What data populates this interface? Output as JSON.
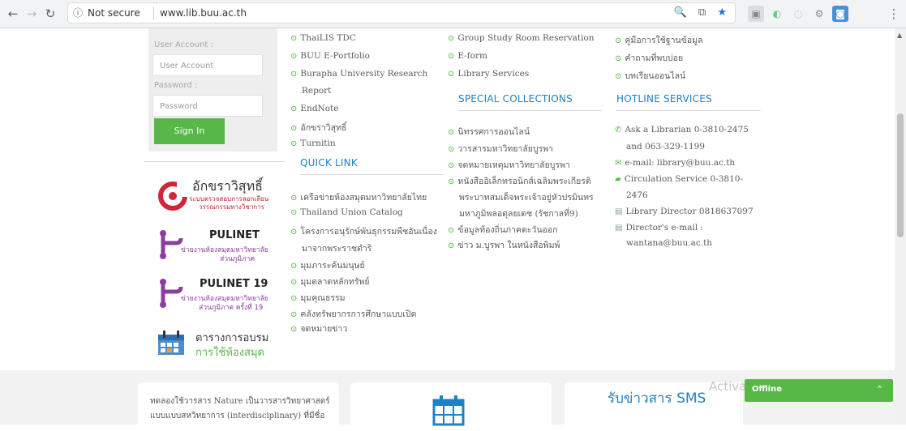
{
  "browser": {
    "security_label": "Not secure",
    "url": "www.lib.buu.ac.th"
  },
  "login": {
    "account_label": "User Account :",
    "account_placeholder": "User Account",
    "password_label": "Password :",
    "password_placeholder": "Password",
    "signin_label": "Sign In"
  },
  "logos": [
    {
      "title": "อักขราวิสุทธิ์",
      "subtitle1": "ระบบตรวจสอบการลอกเลียน",
      "subtitle2": "วรรณกรรมทางวิชาการ"
    },
    {
      "title": "PULINET",
      "subtitle1": "ข่ายงานห้องสมุดมหาวิทยาลัย",
      "subtitle2": "ส่วนภูมิภาค"
    },
    {
      "title": "PULINET 19",
      "subtitle1": "ข่ายงานห้องสมุดมหาวิทยาลัย",
      "subtitle2": "ส่วนภูมิภาค ครั้งที่ 19"
    },
    {
      "title": "ตารางการอบรม",
      "subtitle1": "การใช้ห้องสมุด"
    }
  ],
  "col1": {
    "items": [
      "ThaiLIS TDC",
      "BUU E-Portfolio",
      "Burapha University Research",
      "EndNote",
      "อักขราวิสุทธิ์",
      "Turnitin"
    ],
    "research_cont": "Report",
    "quick_link_heading": "QUICK LINK",
    "quick_links": [
      "เครือข่ายห้องสมุดมหาวิทยาลัยไทย",
      "Thailand Union Catalog",
      "โครงการอนุรักษ์พันธุกรรมพืชอันเนื่อง",
      "มุมภาระค้นมนุษย์",
      "มุมตลาดหลักทรัพย์",
      "มุมคุณธรรม",
      "คลังทรัพยากรการศึกษาแบบเปิด",
      "จดหมายข่าว"
    ],
    "quick_link_cont": "มาจากพระราชดำริ"
  },
  "col2": {
    "items": [
      "Group Study Room Reservation",
      "E-form",
      "Library Services"
    ],
    "special_heading": "SPECIAL COLLECTIONS",
    "special_items": [
      "นิทรรศการออนไลน์",
      "วารสารมหาวิทยาลัยบูรพา",
      "จดหมายเหตุมหาวิทยาลัยบูรพา",
      "หนังสืออิเล็กทรอนิกส์เฉลิมพระเกียรติ",
      "ข้อมูลท้องถิ่นภาคตะวันออก",
      "ข่าว ม.บูรพา ในหนังสือพิมพ์"
    ],
    "special_cont1": "พระบาทสมเด็จพระเจ้าอยู่หัวปรมินทร",
    "special_cont2": "มหาภูมิพลอดุลยเดช (รัชกาลที่9)"
  },
  "col3": {
    "items": [
      "คู่มือการใช้ฐานข้อมูล",
      "คำถามที่พบบ่อย",
      "บทเรียนออนไลน์"
    ],
    "hotline_heading": "HOTLINE SERVICES",
    "hotline": [
      "Ask a Librarian 0-3810-2475",
      "and 063-329-1199",
      "e-mail: library@buu.ac.th",
      "Circulation Service 0-3810-",
      "2476",
      "Library Director 0818637097",
      "Director's e-mail :",
      "wantana@buu.ac.th"
    ]
  },
  "bottom": {
    "card1_line1": "ทดลองใช้วารสาร Nature เป็นวารสารวิทยาศาสตร์",
    "card1_line2": "แบบแบบสหวิทยาการ (interdisciplinary) ที่มีชื่อ",
    "card3_title": "รับข่าวสาร SMS"
  },
  "chat": {
    "label": "Offline",
    "watermark": "Activate Windows"
  },
  "colors": {
    "green": "#57b847",
    "blue": "#1f80c2"
  }
}
